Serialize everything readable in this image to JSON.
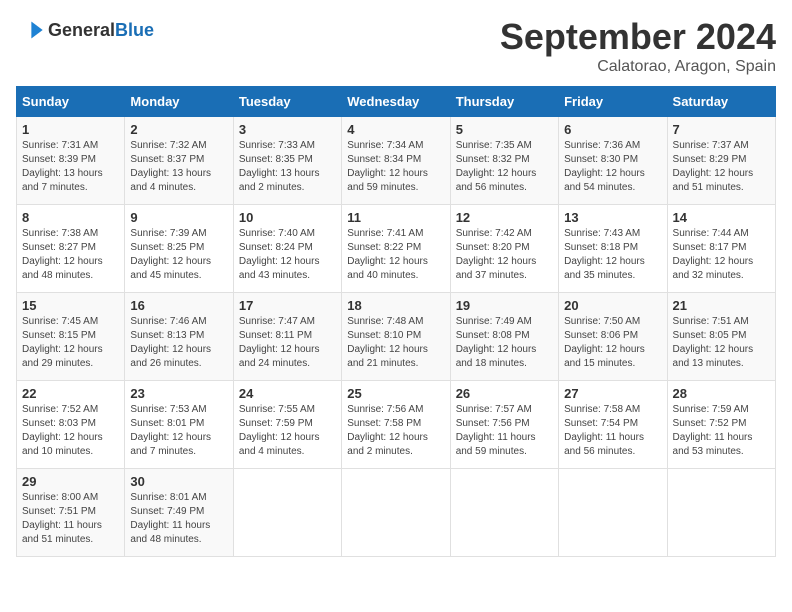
{
  "logo": {
    "general": "General",
    "blue": "Blue"
  },
  "title": "September 2024",
  "location": "Calatorao, Aragon, Spain",
  "days_header": [
    "Sunday",
    "Monday",
    "Tuesday",
    "Wednesday",
    "Thursday",
    "Friday",
    "Saturday"
  ],
  "weeks": [
    [
      {
        "day": "1",
        "sunrise": "7:31 AM",
        "sunset": "8:39 PM",
        "daylight": "13 hours and 7 minutes."
      },
      {
        "day": "2",
        "sunrise": "7:32 AM",
        "sunset": "8:37 PM",
        "daylight": "13 hours and 4 minutes."
      },
      {
        "day": "3",
        "sunrise": "7:33 AM",
        "sunset": "8:35 PM",
        "daylight": "13 hours and 2 minutes."
      },
      {
        "day": "4",
        "sunrise": "7:34 AM",
        "sunset": "8:34 PM",
        "daylight": "12 hours and 59 minutes."
      },
      {
        "day": "5",
        "sunrise": "7:35 AM",
        "sunset": "8:32 PM",
        "daylight": "12 hours and 56 minutes."
      },
      {
        "day": "6",
        "sunrise": "7:36 AM",
        "sunset": "8:30 PM",
        "daylight": "12 hours and 54 minutes."
      },
      {
        "day": "7",
        "sunrise": "7:37 AM",
        "sunset": "8:29 PM",
        "daylight": "12 hours and 51 minutes."
      }
    ],
    [
      {
        "day": "8",
        "sunrise": "7:38 AM",
        "sunset": "8:27 PM",
        "daylight": "12 hours and 48 minutes."
      },
      {
        "day": "9",
        "sunrise": "7:39 AM",
        "sunset": "8:25 PM",
        "daylight": "12 hours and 45 minutes."
      },
      {
        "day": "10",
        "sunrise": "7:40 AM",
        "sunset": "8:24 PM",
        "daylight": "12 hours and 43 minutes."
      },
      {
        "day": "11",
        "sunrise": "7:41 AM",
        "sunset": "8:22 PM",
        "daylight": "12 hours and 40 minutes."
      },
      {
        "day": "12",
        "sunrise": "7:42 AM",
        "sunset": "8:20 PM",
        "daylight": "12 hours and 37 minutes."
      },
      {
        "day": "13",
        "sunrise": "7:43 AM",
        "sunset": "8:18 PM",
        "daylight": "12 hours and 35 minutes."
      },
      {
        "day": "14",
        "sunrise": "7:44 AM",
        "sunset": "8:17 PM",
        "daylight": "12 hours and 32 minutes."
      }
    ],
    [
      {
        "day": "15",
        "sunrise": "7:45 AM",
        "sunset": "8:15 PM",
        "daylight": "12 hours and 29 minutes."
      },
      {
        "day": "16",
        "sunrise": "7:46 AM",
        "sunset": "8:13 PM",
        "daylight": "12 hours and 26 minutes."
      },
      {
        "day": "17",
        "sunrise": "7:47 AM",
        "sunset": "8:11 PM",
        "daylight": "12 hours and 24 minutes."
      },
      {
        "day": "18",
        "sunrise": "7:48 AM",
        "sunset": "8:10 PM",
        "daylight": "12 hours and 21 minutes."
      },
      {
        "day": "19",
        "sunrise": "7:49 AM",
        "sunset": "8:08 PM",
        "daylight": "12 hours and 18 minutes."
      },
      {
        "day": "20",
        "sunrise": "7:50 AM",
        "sunset": "8:06 PM",
        "daylight": "12 hours and 15 minutes."
      },
      {
        "day": "21",
        "sunrise": "7:51 AM",
        "sunset": "8:05 PM",
        "daylight": "12 hours and 13 minutes."
      }
    ],
    [
      {
        "day": "22",
        "sunrise": "7:52 AM",
        "sunset": "8:03 PM",
        "daylight": "12 hours and 10 minutes."
      },
      {
        "day": "23",
        "sunrise": "7:53 AM",
        "sunset": "8:01 PM",
        "daylight": "12 hours and 7 minutes."
      },
      {
        "day": "24",
        "sunrise": "7:55 AM",
        "sunset": "7:59 PM",
        "daylight": "12 hours and 4 minutes."
      },
      {
        "day": "25",
        "sunrise": "7:56 AM",
        "sunset": "7:58 PM",
        "daylight": "12 hours and 2 minutes."
      },
      {
        "day": "26",
        "sunrise": "7:57 AM",
        "sunset": "7:56 PM",
        "daylight": "11 hours and 59 minutes."
      },
      {
        "day": "27",
        "sunrise": "7:58 AM",
        "sunset": "7:54 PM",
        "daylight": "11 hours and 56 minutes."
      },
      {
        "day": "28",
        "sunrise": "7:59 AM",
        "sunset": "7:52 PM",
        "daylight": "11 hours and 53 minutes."
      }
    ],
    [
      {
        "day": "29",
        "sunrise": "8:00 AM",
        "sunset": "7:51 PM",
        "daylight": "11 hours and 51 minutes."
      },
      {
        "day": "30",
        "sunrise": "8:01 AM",
        "sunset": "7:49 PM",
        "daylight": "11 hours and 48 minutes."
      },
      null,
      null,
      null,
      null,
      null
    ]
  ]
}
